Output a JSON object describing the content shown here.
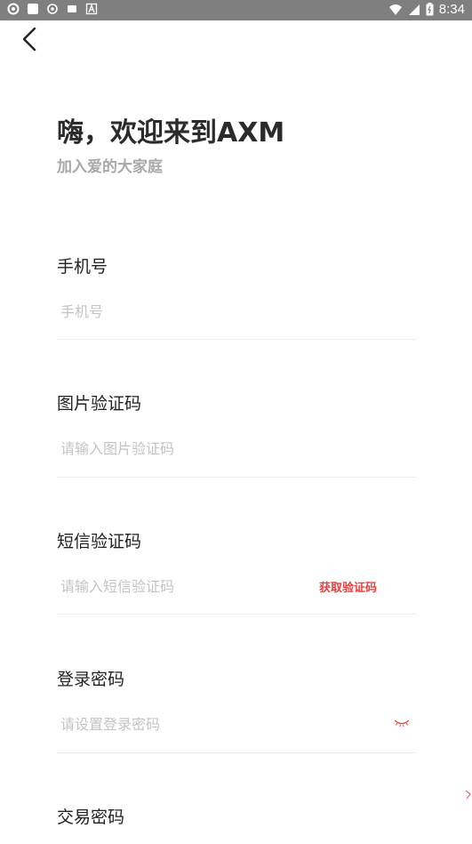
{
  "status_bar": {
    "time": "8:34"
  },
  "header": {
    "title": "嗨，欢迎来到AXM",
    "subtitle": "加入爱的大家庭"
  },
  "form": {
    "phone": {
      "label": "手机号",
      "placeholder": "手机号",
      "value": ""
    },
    "captcha": {
      "label": "图片验证码",
      "placeholder": "请输入图片验证码",
      "value": ""
    },
    "sms": {
      "label": "短信验证码",
      "placeholder": "请输入短信验证码",
      "value": "",
      "get_code_label": "获取验证码"
    },
    "login_password": {
      "label": "登录密码",
      "placeholder": "请设置登录密码",
      "value": ""
    },
    "trade_password": {
      "label": "交易密码"
    }
  },
  "colors": {
    "accent": "#e8423f",
    "status_bar": "#7f7f7f",
    "placeholder": "#c4c4c4"
  }
}
